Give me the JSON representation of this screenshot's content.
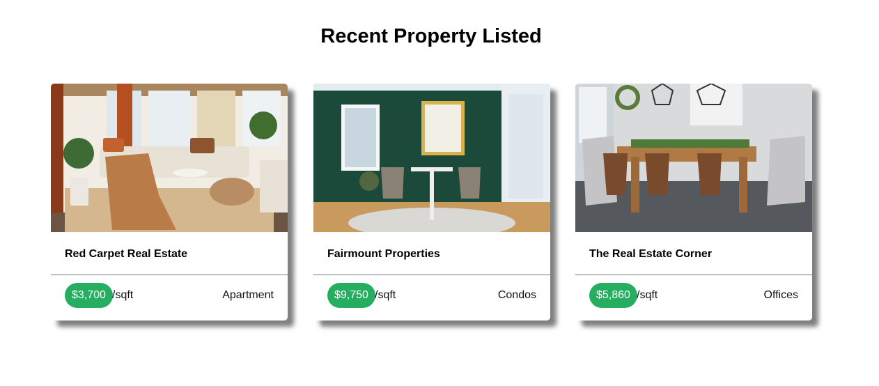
{
  "heading": "Recent Property Listed",
  "listings": [
    {
      "name": "Red Carpet Real Estate",
      "price": "$3,700",
      "unit": "/sqft",
      "type": "Apartment",
      "image_icon": "living-room-photo"
    },
    {
      "name": "Fairmount Properties",
      "price": "$9,750",
      "unit": "/sqft",
      "type": "Condos",
      "image_icon": "dining-nook-photo"
    },
    {
      "name": "The Real Estate Corner",
      "price": "$5,860",
      "unit": "/sqft",
      "type": "Offices",
      "image_icon": "dining-room-photo"
    }
  ],
  "colors": {
    "price_badge": "#25ae5f",
    "divider": "#777777"
  }
}
